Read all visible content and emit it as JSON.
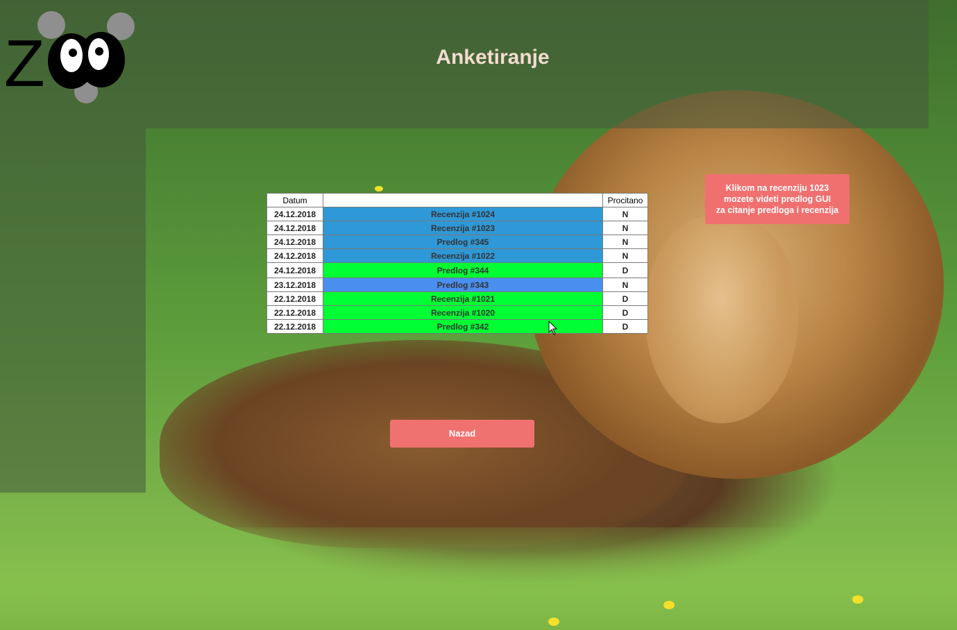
{
  "page": {
    "title": "Anketiranje"
  },
  "table": {
    "headers": [
      "Datum",
      "",
      "Procitano"
    ],
    "rows": [
      {
        "date": "24.12.2018",
        "name": "Recenzija #1024",
        "read": "N",
        "color": "#2f98d6"
      },
      {
        "date": "24.12.2018",
        "name": "Recenzija #1023",
        "read": "N",
        "color": "#2f98d6"
      },
      {
        "date": "24.12.2018",
        "name": "Predlog #345",
        "read": "N",
        "color": "#2f98d6"
      },
      {
        "date": "24.12.2018",
        "name": "Recenzija #1022",
        "read": "N",
        "color": "#2f98d6"
      },
      {
        "date": "24.12.2018",
        "name": "Predlog #344",
        "read": "D",
        "color": "#00ff33"
      },
      {
        "date": "23.12.2018",
        "name": "Predlog #343",
        "read": "N",
        "color": "#4a8ff0"
      },
      {
        "date": "22.12.2018",
        "name": "Recenzija #1021",
        "read": "D",
        "color": "#00ff33"
      },
      {
        "date": "22.12.2018",
        "name": "Recenzija #1020",
        "read": "D",
        "color": "#00ff33"
      },
      {
        "date": "22.12.2018",
        "name": "Predlog #342",
        "read": "D",
        "color": "#00ff33"
      }
    ]
  },
  "hint": {
    "line1": "Klikom na recenziju 1023",
    "line2": "mozete videti predlog GUI",
    "line3": "za citanje predloga i recenzija"
  },
  "buttons": {
    "back_label": "Nazad"
  },
  "colors": {
    "accent": "#f07070",
    "title": "#f3dcd0",
    "unread_review": "#2f98d6",
    "read": "#00ff33",
    "unread_proposal": "#4a8ff0"
  },
  "logo": {
    "text": "Z"
  }
}
